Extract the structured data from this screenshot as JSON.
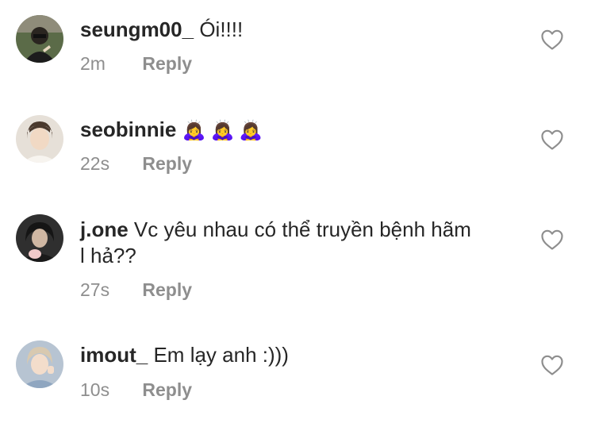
{
  "comments": [
    {
      "username": "seungm00_",
      "text": "Ói!!!!",
      "time": "2m",
      "reply_label": "Reply",
      "avatar_color": "#4a5a3c"
    },
    {
      "username": "seobinnie",
      "text": "🙇‍♀️🙇‍♀️🙇‍♀️",
      "time": "22s",
      "reply_label": "Reply",
      "avatar_color": "#d9cfc3"
    },
    {
      "username": "j.one",
      "text": "Vc yêu nhau có thể truyền bệnh hãm l hả??",
      "time": "27s",
      "reply_label": "Reply",
      "avatar_color": "#3a3a3a"
    },
    {
      "username": "imout_",
      "text": "Em lạy anh :)))",
      "time": "10s",
      "reply_label": "Reply",
      "avatar_color": "#a9b8c8"
    }
  ],
  "icons": {
    "like": "heart-outline-icon"
  },
  "colors": {
    "text": "#262626",
    "secondary": "#8e8e8e",
    "background": "#ffffff"
  }
}
